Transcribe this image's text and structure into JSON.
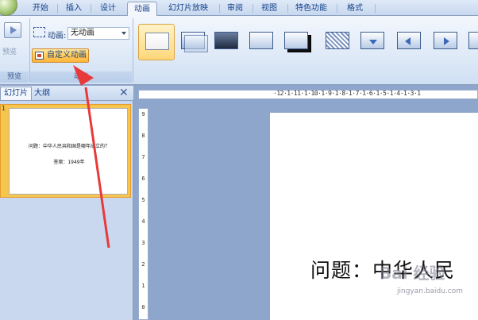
{
  "tabs": [
    "开始",
    "插入",
    "设计",
    "动画",
    "幻灯片放映",
    "审阅",
    "视图",
    "特色功能",
    "格式"
  ],
  "active_tab": "动画",
  "ribbon": {
    "preview_label": "预览",
    "preview_group": "预览",
    "animation_label": "动画:",
    "animation_value": "无动画",
    "custom_animation": "自定义动画",
    "animation_group": "动画"
  },
  "pane": {
    "tab_slides": "幻灯片",
    "tab_outline": "大纲",
    "close": "✕"
  },
  "thumb_number": "1",
  "slide": {
    "question": "问题：中华人民共和国是哪年成立的？",
    "answer": "答案：1949年",
    "visible_title": "问题：中华人民"
  },
  "ruler": {
    "h": "·12·1·11·1·10·1·9·1·8·1·7·1·6·1·5·1·4·1·3·1",
    "v": [
      "9",
      "8",
      "7",
      "6",
      "5",
      "4",
      "3",
      "2",
      "1",
      "0"
    ]
  },
  "watermark": {
    "brand": "Bai 经验",
    "url": "jingyan.baidu.com"
  },
  "colors": {
    "accent": "#ffcf60",
    "arrow": "#e83a3a"
  }
}
